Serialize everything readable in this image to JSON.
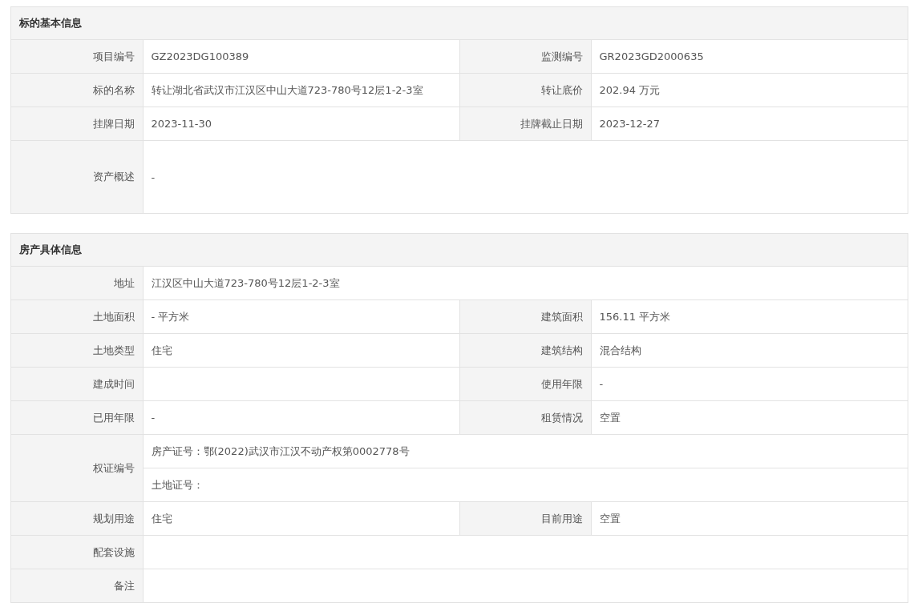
{
  "sections": [
    {
      "title": "标的基本信息",
      "rows": [
        {
          "kind": "pair",
          "cells": [
            {
              "label": "项目编号",
              "value": "GZ2023DG100389"
            },
            {
              "label": "监测编号",
              "value": "GR2023GD2000635"
            }
          ]
        },
        {
          "kind": "pair",
          "cells": [
            {
              "label": "标的名称",
              "value": "转让湖北省武汉市江汉区中山大道723-780号12层1-2-3室"
            },
            {
              "label": "转让底价",
              "value": "202.94 万元"
            }
          ]
        },
        {
          "kind": "pair",
          "cells": [
            {
              "label": "挂牌日期",
              "value": "2023-11-30"
            },
            {
              "label": "挂牌截止日期",
              "value": "2023-12-27"
            }
          ]
        },
        {
          "kind": "tall",
          "label": "资产概述",
          "value": "-"
        }
      ]
    },
    {
      "title": "房产具体信息",
      "rows": [
        {
          "kind": "wide",
          "label": "地址",
          "value": "江汉区中山大道723-780号12层1-2-3室"
        },
        {
          "kind": "pair",
          "cells": [
            {
              "label": "土地面积",
              "value": "- 平方米"
            },
            {
              "label": "建筑面积",
              "value": "156.11 平方米"
            }
          ]
        },
        {
          "kind": "pair",
          "cells": [
            {
              "label": "土地类型",
              "value": "住宅"
            },
            {
              "label": "建筑结构",
              "value": "混合结构"
            }
          ]
        },
        {
          "kind": "pair",
          "cells": [
            {
              "label": "建成时间"
            },
            {
              "label": "使用年限",
              "value": "-"
            }
          ]
        },
        {
          "kind": "pair",
          "cells": [
            {
              "label": "已用年限",
              "value": "-"
            },
            {
              "label": "租赁情况",
              "value": "空置"
            }
          ]
        },
        {
          "kind": "multi",
          "label": "权证编号",
          "lines": [
            "房产证号：鄂(2022)武汉市江汉不动产权第0002778号",
            "土地证号："
          ]
        },
        {
          "kind": "pair",
          "cells": [
            {
              "label": "规划用途",
              "value": "住宅"
            },
            {
              "label": "目前用途",
              "value": "空置"
            }
          ]
        },
        {
          "kind": "wide",
          "label": "配套设施"
        },
        {
          "kind": "wide",
          "label": "备注"
        }
      ]
    }
  ]
}
